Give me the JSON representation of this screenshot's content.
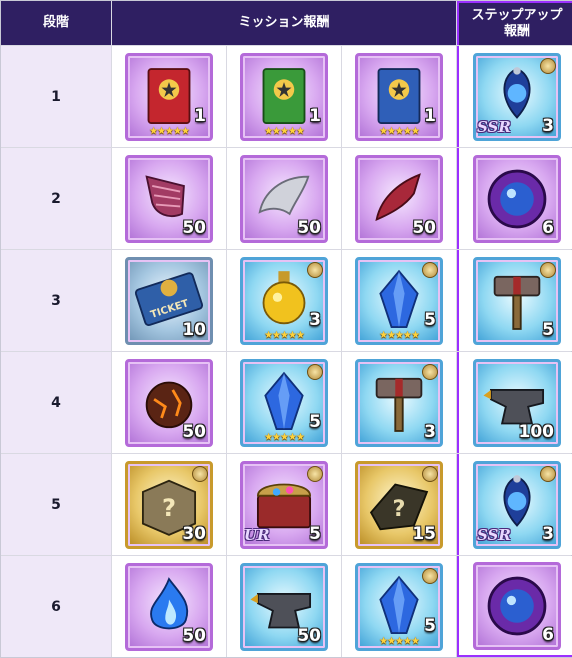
{
  "headers": {
    "stage": "段階",
    "mission_reward": "ミッション報酬",
    "stepup_reward": "ステップアップ\n報酬"
  },
  "colors": {
    "header_bg": "#2f1f62",
    "stage_bg": "#efe8f8",
    "stepup_highlight": "#9b30ff"
  },
  "rows": [
    {
      "stage": "1",
      "missions": [
        {
          "icon": "red-star-book-icon",
          "qty": "1",
          "stars": "★★★★★",
          "frame": "purple"
        },
        {
          "icon": "green-star-book-icon",
          "qty": "1",
          "stars": "★★★★★",
          "frame": "purple"
        },
        {
          "icon": "blue-star-book-icon",
          "qty": "1",
          "stars": "★★★★★",
          "frame": "purple"
        }
      ],
      "stepup": {
        "icon": "blue-gem-amulet-icon",
        "qty": "3",
        "rarity": "SSR",
        "frame": "blue",
        "badge": true
      }
    },
    {
      "stage": "2",
      "missions": [
        {
          "icon": "spiral-horn-icon",
          "qty": "50",
          "frame": "purple"
        },
        {
          "icon": "silver-wing-icon",
          "qty": "50",
          "frame": "purple"
        },
        {
          "icon": "red-feather-icon",
          "qty": "50",
          "frame": "purple"
        }
      ],
      "stepup": {
        "icon": "rainbow-orb-icon",
        "qty": "6",
        "frame": "purple"
      }
    },
    {
      "stage": "3",
      "missions": [
        {
          "icon": "ticket-icon",
          "qty": "10",
          "frame": "ticket",
          "label": "TICKET"
        },
        {
          "icon": "golden-potion-icon",
          "qty": "3",
          "stars": "★★★★★",
          "frame": "blue",
          "badge": true
        },
        {
          "icon": "blue-crystal-icon",
          "qty": "5",
          "stars": "★★★★★",
          "frame": "blue",
          "badge": true
        }
      ],
      "stepup": {
        "icon": "hammer-icon",
        "qty": "5",
        "frame": "blue",
        "badge": true
      }
    },
    {
      "stage": "4",
      "missions": [
        {
          "icon": "lava-ore-icon",
          "qty": "50",
          "frame": "purple"
        },
        {
          "icon": "blue-crystal-icon",
          "qty": "5",
          "stars": "★★★★★",
          "frame": "blue",
          "badge": true
        },
        {
          "icon": "hammer-icon",
          "qty": "3",
          "frame": "blue",
          "badge": true
        }
      ],
      "stepup": {
        "icon": "anvil-icon",
        "qty": "100",
        "frame": "blue"
      }
    },
    {
      "stage": "5",
      "missions": [
        {
          "icon": "mystery-box-icon",
          "qty": "30",
          "frame": "gold",
          "badge": true
        },
        {
          "icon": "treasure-chest-icon",
          "qty": "5",
          "rarity": "UR",
          "frame": "purple",
          "badge": true
        },
        {
          "icon": "mystery-shard-icon",
          "qty": "15",
          "frame": "gold",
          "badge": true
        }
      ],
      "stepup": {
        "icon": "blue-gem-amulet-icon",
        "qty": "3",
        "rarity": "SSR",
        "frame": "blue",
        "badge": true
      }
    },
    {
      "stage": "6",
      "missions": [
        {
          "icon": "blue-flame-icon",
          "qty": "50",
          "frame": "purple"
        },
        {
          "icon": "anvil-icon",
          "qty": "50",
          "frame": "blue"
        },
        {
          "icon": "blue-crystal-icon",
          "qty": "5",
          "stars": "★★★★★",
          "frame": "blue",
          "badge": true
        }
      ],
      "stepup": {
        "icon": "rainbow-orb-icon",
        "qty": "6",
        "frame": "purple"
      }
    }
  ]
}
